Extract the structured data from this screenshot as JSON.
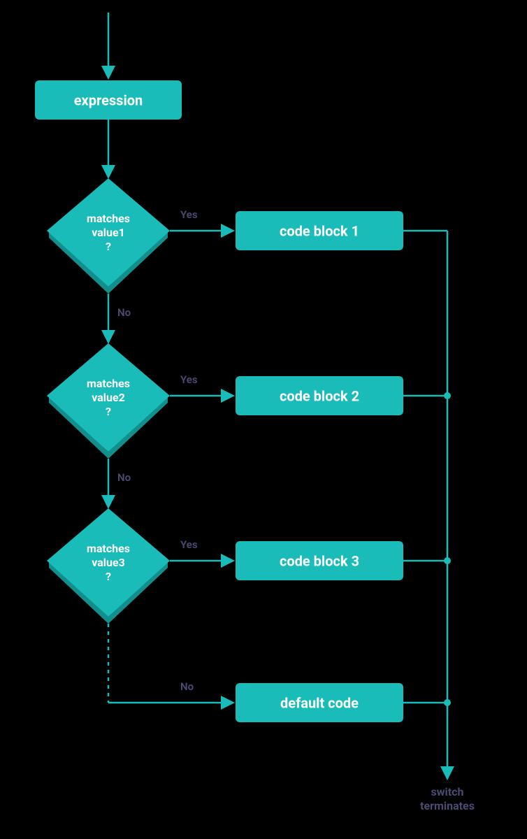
{
  "colors": {
    "teal": "#1abcb9",
    "teal_dark": "#128f8d",
    "label": "#4b4b73",
    "white": "#ffffff"
  },
  "nodes": {
    "expression": "expression",
    "d1_l1": "matches",
    "d1_l2": "value1",
    "d1_l3": "?",
    "d2_l1": "matches",
    "d2_l2": "value2",
    "d2_l3": "?",
    "d3_l1": "matches",
    "d3_l2": "value3",
    "d3_l3": "?",
    "cb1": "code block 1",
    "cb2": "code block 2",
    "cb3": "code block 3",
    "def": "default code"
  },
  "edges": {
    "yes": "Yes",
    "no": "No"
  },
  "terminate_l1": "switch",
  "terminate_l2": "terminates"
}
